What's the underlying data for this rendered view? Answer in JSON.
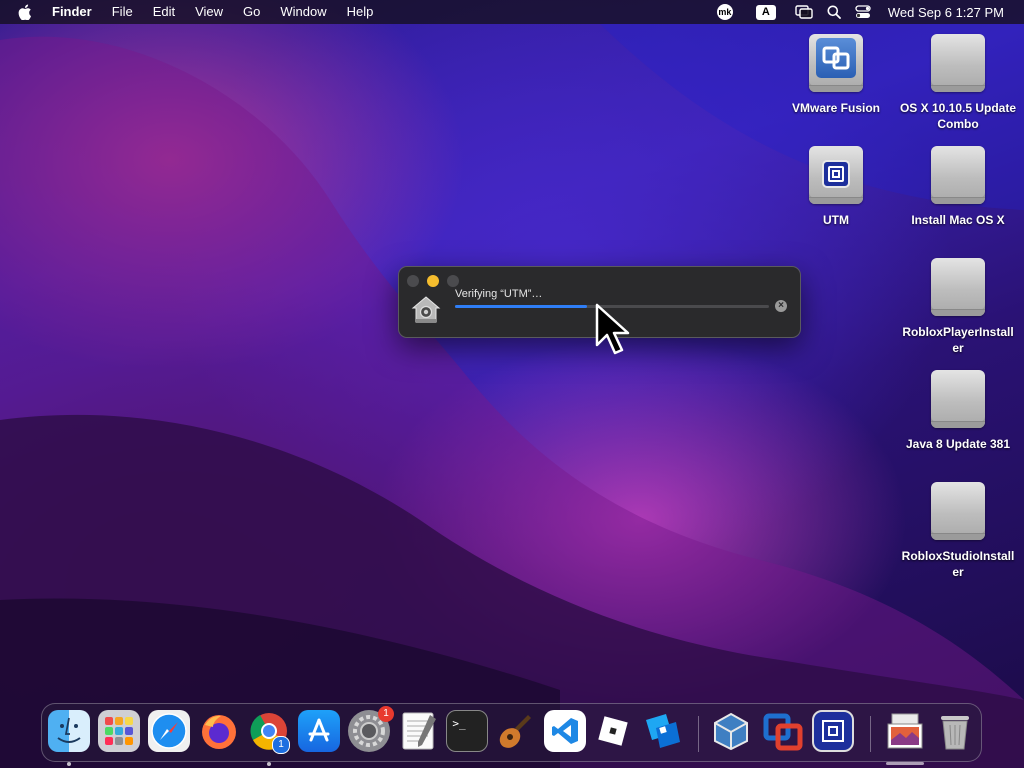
{
  "menubar": {
    "app_name": "Finder",
    "menus": [
      "File",
      "Edit",
      "View",
      "Go",
      "Window",
      "Help"
    ],
    "status": {
      "mk_label": "mk",
      "input_source": "A",
      "datetime": "Wed Sep 6  1:27 PM"
    }
  },
  "desktop_icons": [
    {
      "label": "VMware Fusion",
      "icon": "vmware-disk-icon"
    },
    {
      "label": "OS X 10.10.5 Update Combo",
      "icon": "disk-image-icon"
    },
    {
      "label": "UTM",
      "icon": "utm-disk-icon"
    },
    {
      "label": "Install Mac OS X",
      "icon": "disk-image-icon"
    },
    {
      "label": "RobloxPlayerInstaller",
      "icon": "disk-image-icon"
    },
    {
      "label": "Java 8 Update 381",
      "icon": "disk-image-icon"
    },
    {
      "label": "RobloxStudioInstaller",
      "icon": "disk-image-icon"
    }
  ],
  "progress_window": {
    "text": "Verifying “UTM”…",
    "progress": 0.42,
    "accent": "#2f7ef6"
  },
  "dock": {
    "items": [
      {
        "name": "finder",
        "running": true
      },
      {
        "name": "launchpad",
        "running": false
      },
      {
        "name": "safari",
        "running": false
      },
      {
        "name": "firefox",
        "running": false
      },
      {
        "name": "chrome",
        "running": true,
        "badge": "1"
      },
      {
        "name": "app-store",
        "running": false
      },
      {
        "name": "system-settings",
        "running": false,
        "badge": "1"
      },
      {
        "name": "textedit",
        "running": false
      },
      {
        "name": "terminal",
        "running": false
      },
      {
        "name": "garageband",
        "running": false
      },
      {
        "name": "vscode",
        "running": false
      },
      {
        "name": "roblox-player",
        "running": false
      },
      {
        "name": "roblox-studio",
        "running": false
      },
      {
        "name": "virtualbox",
        "running": false
      },
      {
        "name": "vmware-fusion",
        "running": false
      },
      {
        "name": "utm",
        "running": false
      },
      {
        "name": "preview-stack",
        "running": false
      },
      {
        "name": "trash",
        "running": false
      }
    ]
  }
}
